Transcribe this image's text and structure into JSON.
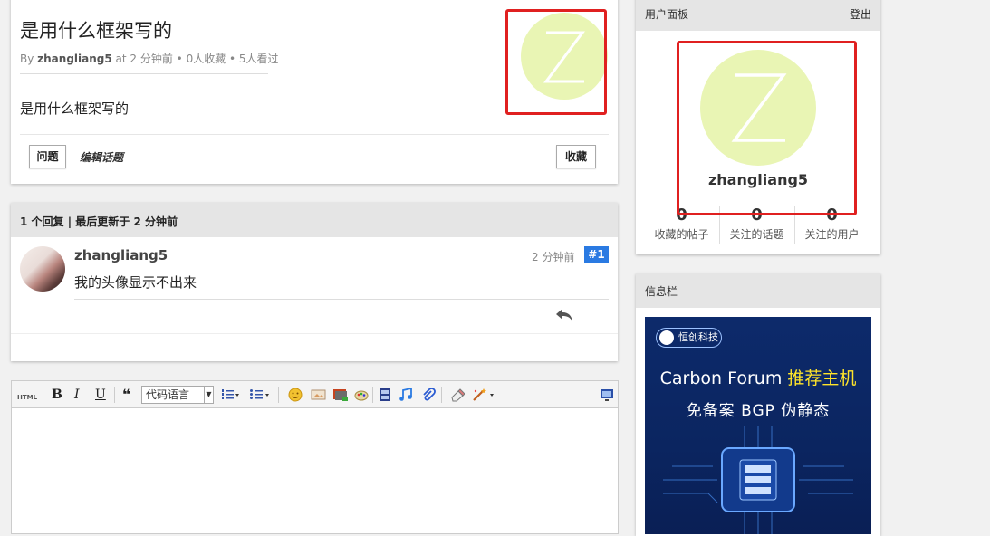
{
  "topic": {
    "title": "是用什么框架写的",
    "meta_prefix": "By ",
    "author": "zhangliang5",
    "meta_suffix": " at 2 分钟前 • 0人收藏 • 5人看过",
    "body": "是用什么框架写的",
    "tag_label": "问题",
    "edit_label": "编辑话题",
    "favorite_label": "收藏",
    "avatar_letter": "Z"
  },
  "replies": {
    "header": "1 个回复 | 最后更新于 2 分钟前",
    "items": [
      {
        "user": "zhangliang5",
        "time": "2 分钟前",
        "floor": "#1",
        "content": "我的头像显示不出来"
      }
    ]
  },
  "editor": {
    "toolbar": {
      "html_label": "HTML",
      "bold": "B",
      "italic": "I",
      "underline": "U",
      "quote": "❝",
      "code_lang": "代码语言"
    }
  },
  "user_panel": {
    "title": "用户面板",
    "logout": "登出",
    "avatar_letter": "Z",
    "username": "zhangliang5",
    "stats": [
      {
        "value": "0",
        "label": "收藏的帖子"
      },
      {
        "value": "0",
        "label": "关注的话题"
      },
      {
        "value": "0",
        "label": "关注的用户"
      }
    ]
  },
  "info_panel": {
    "title": "信息栏",
    "ad": {
      "logo_text": "恒创科技",
      "line1_prefix": "Carbon Forum ",
      "line1_highlight": "推荐主机",
      "line2": "免备案 BGP 伪静态"
    }
  },
  "colors": {
    "avatar_bg": "#e9f5b4",
    "highlight_red": "#e02020",
    "floor_badge": "#2a7ae2"
  }
}
